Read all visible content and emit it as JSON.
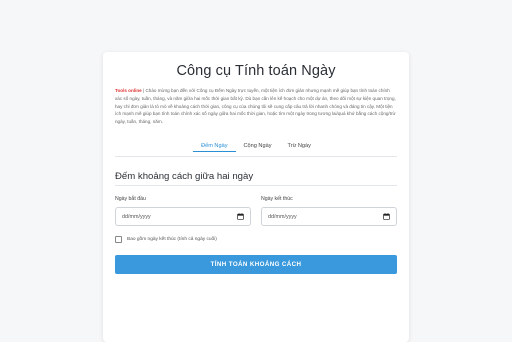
{
  "page": {
    "title": "Công cụ Tính toán Ngày",
    "intro_brand": "Tools online",
    "intro_text": " | Chào mừng bạn đến với Công cụ Đếm Ngày trực tuyến, một tiện ích đơn giản nhưng mạnh mẽ giúp bạn tính toán chính xác số ngày, tuần, tháng, và năm giữa hai mốc thời gian bất kỳ. Dù bạn cần lên kế hoạch cho một dự án, theo dõi một sự kiện quan trọng, hay chỉ đơn giản là tò mò về khoảng cách thời gian, công cụ của chúng tôi sẽ cung cấp câu trả lời nhanh chóng và đáng tin cậy. Một tiện ích mạnh mẽ giúp bạn tính toán chính xác số ngày giữa hai mốc thời gian, hoặc tìm một ngày trong tương lai/quá khứ bằng cách cộng/trừ ngày, tuần, tháng, năm."
  },
  "tabs": [
    {
      "label": "Đếm Ngày",
      "active": true
    },
    {
      "label": "Cộng Ngày",
      "active": false
    },
    {
      "label": "Trừ Ngày",
      "active": false
    }
  ],
  "section": {
    "title": "Đếm khoảng cách giữa hai ngày",
    "start_label": "Ngày bắt đầu",
    "start_placeholder": "dd/mm/yyyy",
    "end_label": "Ngày kết thúc",
    "end_placeholder": "dd/mm/yyyy",
    "include_end_label": "Bao gồm ngày kết thúc (tính cả ngày cuối)",
    "include_end_checked": false,
    "button_label": "TÍNH TOÁN KHOẢNG CÁCH"
  },
  "colors": {
    "accent": "#3a99dd",
    "brand_red": "#e03131",
    "active_tab": "#2b8fd6"
  },
  "icons": {
    "date_picker": "calendar-icon"
  }
}
